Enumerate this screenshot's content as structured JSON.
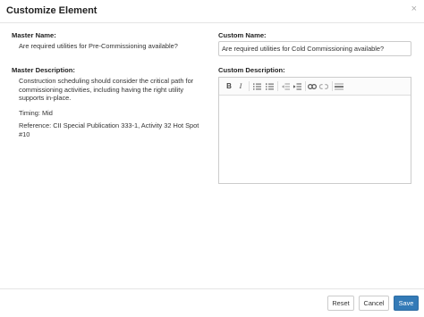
{
  "modal": {
    "title": "Customize Element",
    "close_glyph": "×"
  },
  "master": {
    "name_label": "Master Name:",
    "name_value": "Are required utilities for Pre-Commissioning available?",
    "description_label": "Master Description:",
    "description_paragraphs": [
      "Construction scheduling should consider the critical path for commissioning activities, including having the right utility supports in-place.",
      "Timing: Mid",
      "Reference: CII Special Publication 333-1, Activity 32 Hot Spot #10"
    ]
  },
  "custom": {
    "name_label": "Custom Name:",
    "name_value": "Are required utilities for Cold Commissioning available?",
    "description_label": "Custom Description:",
    "description_value": ""
  },
  "toolbar": {
    "bold_glyph": "B",
    "italic_glyph": "I",
    "buttons": [
      "bold-icon",
      "italic-icon",
      "numbered-list-icon",
      "bullet-list-icon",
      "outdent-icon",
      "indent-icon",
      "link-icon",
      "unlink-icon",
      "horizontal-rule-icon"
    ]
  },
  "footer": {
    "reset_label": "Reset",
    "cancel_label": "Cancel",
    "save_label": "Save"
  },
  "colors": {
    "primary": "#337ab7",
    "border": "#cccccc",
    "divider": "#e5e5e5"
  }
}
